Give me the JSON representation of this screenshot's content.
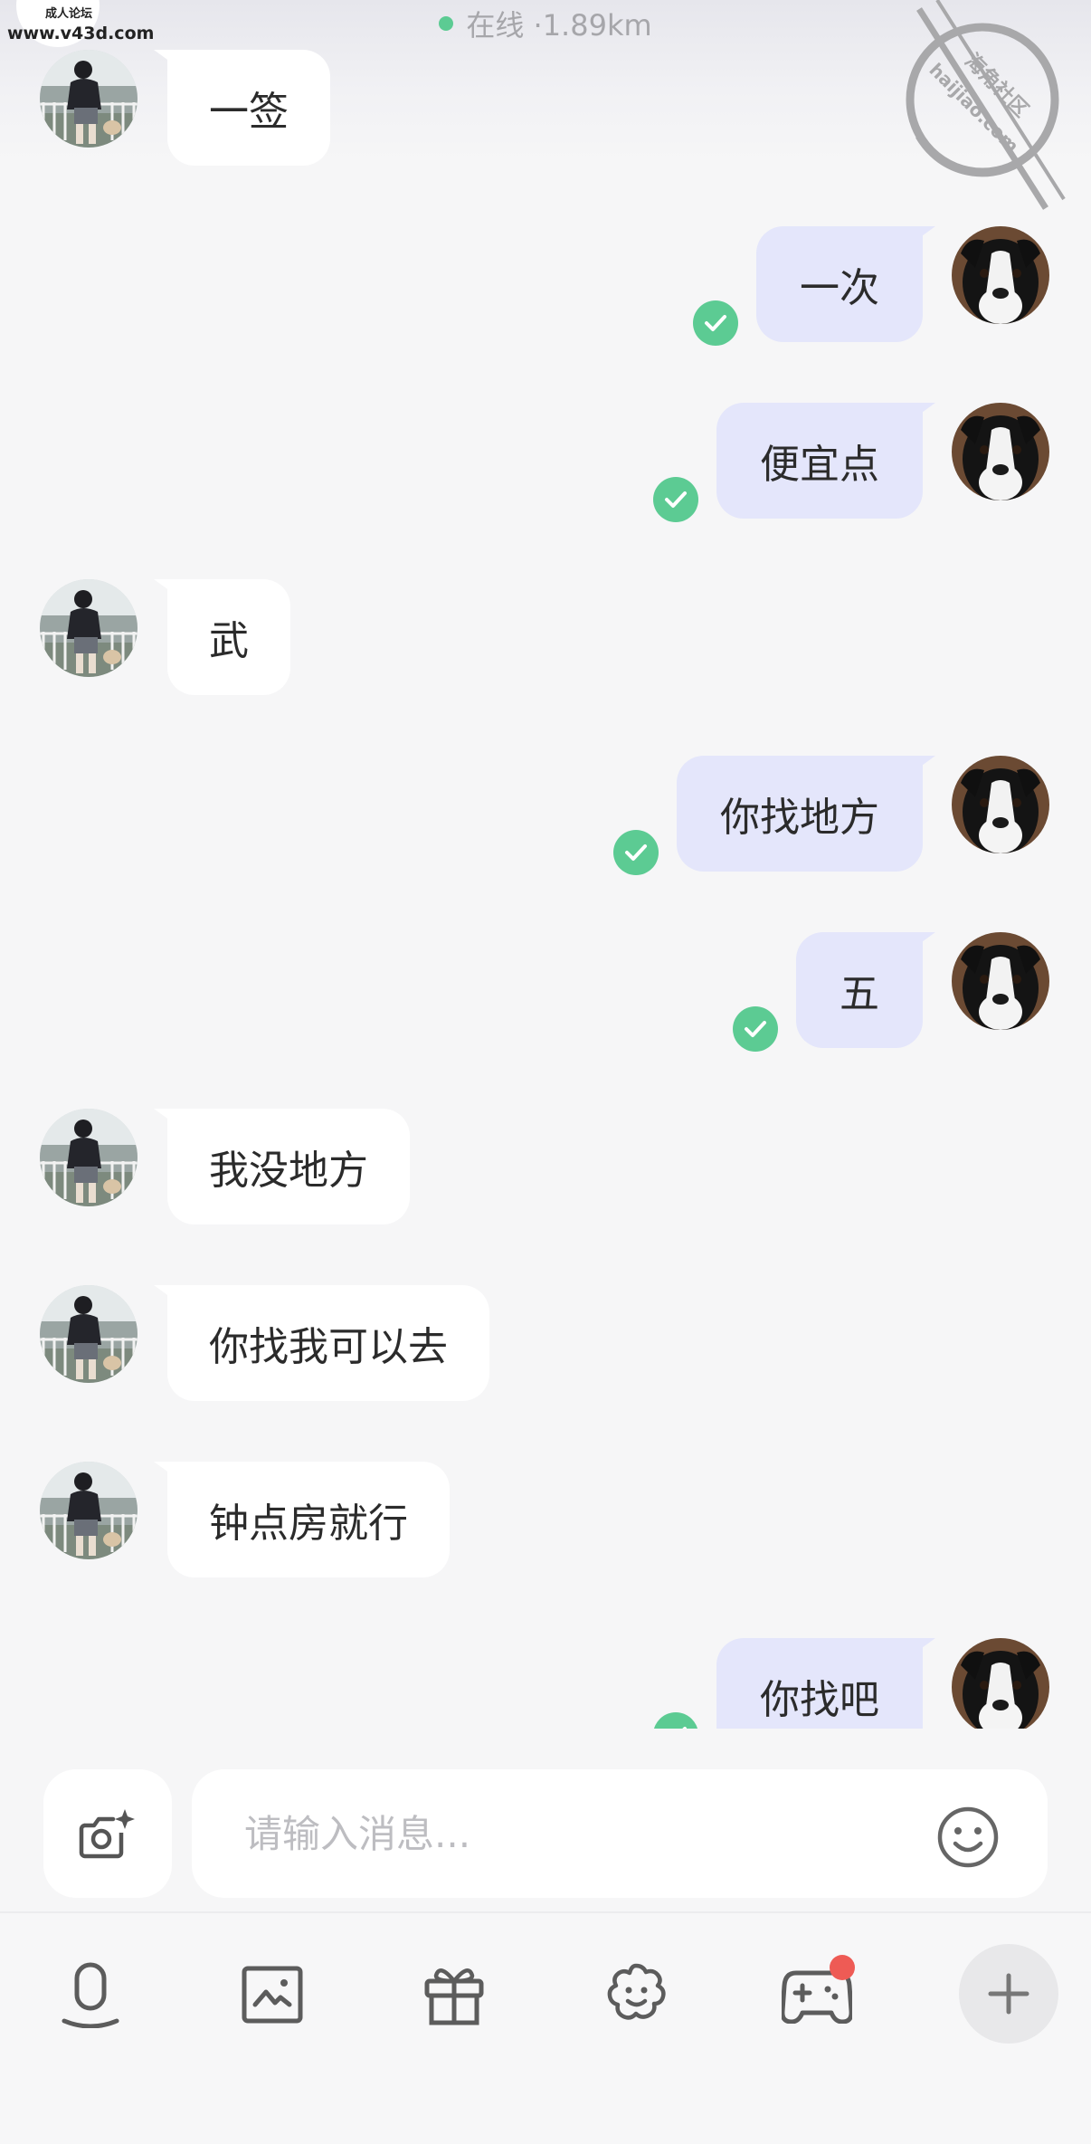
{
  "header": {
    "status_text": "在线 ·1.89km",
    "online_color": "#5ccb93"
  },
  "watermarks": {
    "site_url": "www.v43d.com",
    "site_tag": "成人论坛",
    "stamp_cn": "海角社区",
    "stamp_en": "haijiao.com"
  },
  "messages": [
    {
      "side": "in",
      "text": "一签",
      "avatar": "user-avatar"
    },
    {
      "side": "out",
      "text": "一次",
      "avatar": "dog-avatar",
      "read": true
    },
    {
      "side": "out",
      "text": "便宜点",
      "avatar": "dog-avatar",
      "read": true
    },
    {
      "side": "in",
      "text": "武",
      "avatar": "user-avatar"
    },
    {
      "side": "out",
      "text": "你找地方",
      "avatar": "dog-avatar",
      "read": true
    },
    {
      "side": "out",
      "text": "五",
      "avatar": "dog-avatar",
      "read": true
    },
    {
      "side": "in",
      "text": "我没地方",
      "avatar": "user-avatar"
    },
    {
      "side": "in",
      "text": "你找我可以去",
      "avatar": "user-avatar"
    },
    {
      "side": "in",
      "text": "钟点房就行",
      "avatar": "user-avatar"
    },
    {
      "side": "out",
      "text": "你找吧",
      "avatar": "dog-avatar",
      "read": true
    }
  ],
  "colors": {
    "outgoing_bubble": "#e4e6fb",
    "incoming_bubble": "#ffffff",
    "read_check": "#5ccb93",
    "notification_dot": "#ee5b55"
  },
  "composer": {
    "placeholder": "请输入消息...",
    "camera_icon": "camera-sparkle-icon",
    "emoji_icon": "smiley-icon"
  },
  "toolbar": {
    "items": [
      {
        "icon": "voice-icon"
      },
      {
        "icon": "image-icon"
      },
      {
        "icon": "gift-icon"
      },
      {
        "icon": "sticker-icon"
      },
      {
        "icon": "game-controller-icon",
        "badge": true
      },
      {
        "icon": "plus-icon"
      }
    ]
  }
}
